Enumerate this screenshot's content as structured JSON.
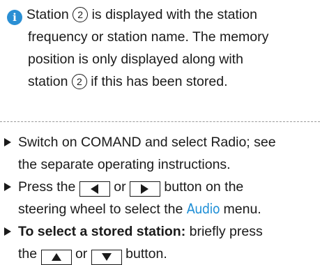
{
  "note": {
    "icon": "info-icon",
    "lines": {
      "l1a": "Station",
      "l1b": "is displayed with the station",
      "l2": "frequency or station name. The memory",
      "l3": "position is only displayed along with",
      "l4a": "station",
      "l4b": "if this has been stored."
    },
    "station_ref": "2"
  },
  "steps": [
    {
      "line1": "Switch on COMAND and select Radio; see",
      "line2": "the separate operating instructions."
    },
    {
      "line1a": "Press the",
      "line1b": "or",
      "line1c": "button on the",
      "line2a": "steering wheel to select the",
      "menu": "Audio",
      "line2b": "menu.",
      "keys": [
        "left-arrow-key",
        "right-arrow-key"
      ]
    },
    {
      "bold": "To select a stored station:",
      "line1b": "briefly press",
      "line2a": "the",
      "line2b": "or",
      "line2c": "button.",
      "keys": [
        "up-arrow-key",
        "down-arrow-key"
      ]
    }
  ],
  "colors": {
    "accent": "#1f8fd6",
    "info_icon": "#2a8fd4",
    "text": "#1a1a1a"
  }
}
